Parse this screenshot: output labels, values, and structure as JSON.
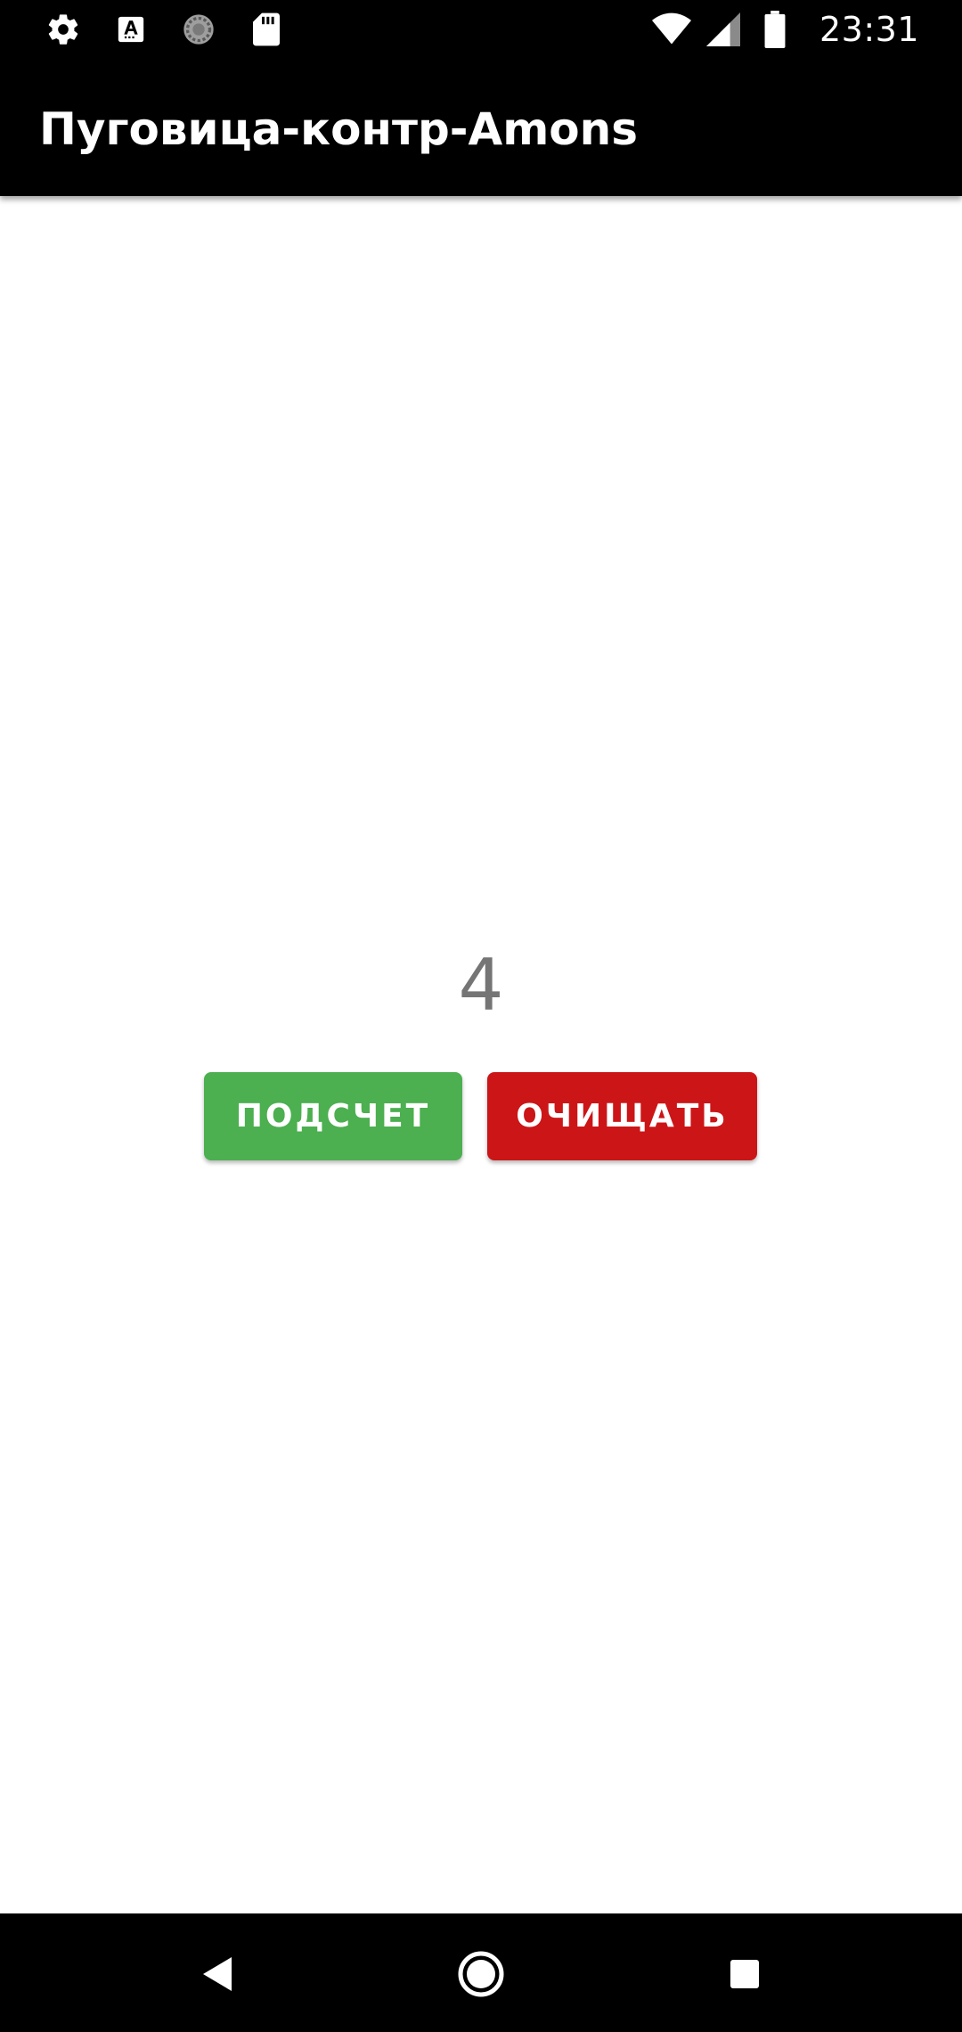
{
  "status_bar": {
    "time": "23:31",
    "left_icons": [
      "settings-icon",
      "text-a-icon",
      "sync-circle-icon",
      "sd-card-icon"
    ],
    "right_icons": [
      "wifi-icon",
      "cell-signal-icon",
      "battery-icon"
    ]
  },
  "app_bar": {
    "title": "Пуговица-контр-Amons"
  },
  "main": {
    "counter_value": "4",
    "count_button_label": "ПОДСЧЕТ",
    "clear_button_label": "ОЧИЩАТЬ"
  },
  "colors": {
    "count_button": "#4caf50",
    "clear_button": "#cc1517",
    "counter_text": "#757575",
    "bars": "#000000"
  },
  "nav_bar": {
    "icons": [
      "back-icon",
      "home-icon",
      "recents-icon"
    ]
  }
}
